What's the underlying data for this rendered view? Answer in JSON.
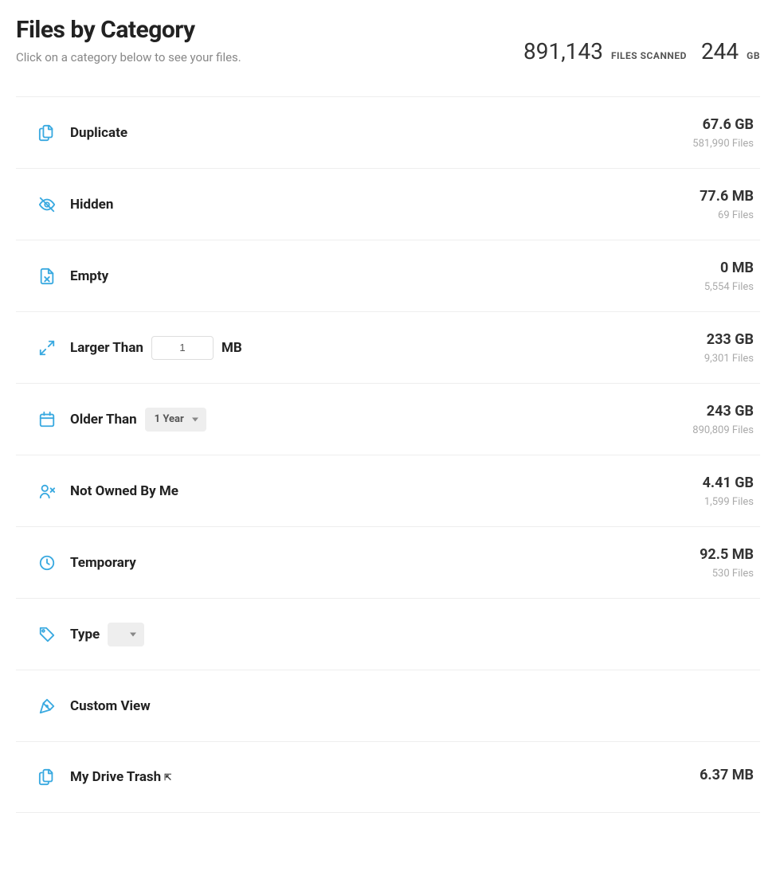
{
  "header": {
    "title": "Files by Category",
    "subtitle": "Click on a category below to see your files.",
    "files_scanned_value": "891,143",
    "files_scanned_label": "FILES SCANNED",
    "total_size_value": "244",
    "total_size_unit": "GB"
  },
  "labels": {
    "mb": "MB"
  },
  "categories": [
    {
      "id": "duplicate",
      "label": "Duplicate",
      "size": "67.6 GB",
      "files": "581,990 Files"
    },
    {
      "id": "hidden",
      "label": "Hidden",
      "size": "77.6 MB",
      "files": "69 Files"
    },
    {
      "id": "empty",
      "label": "Empty",
      "size": "0 MB",
      "files": "5,554 Files"
    },
    {
      "id": "larger-than",
      "label": "Larger Than",
      "size": "233 GB",
      "files": "9,301 Files",
      "input_value": "1"
    },
    {
      "id": "older-than",
      "label": "Older Than",
      "size": "243 GB",
      "files": "890,809 Files",
      "dropdown_value": "1 Year"
    },
    {
      "id": "not-owned",
      "label": "Not Owned By Me",
      "size": "4.41 GB",
      "files": "1,599 Files"
    },
    {
      "id": "temporary",
      "label": "Temporary",
      "size": "92.5 MB",
      "files": "530 Files"
    },
    {
      "id": "type",
      "label": "Type",
      "dropdown_value": ""
    },
    {
      "id": "custom-view",
      "label": "Custom View"
    },
    {
      "id": "trash",
      "label": "My Drive Trash",
      "size": "6.37 MB",
      "external": true
    }
  ]
}
